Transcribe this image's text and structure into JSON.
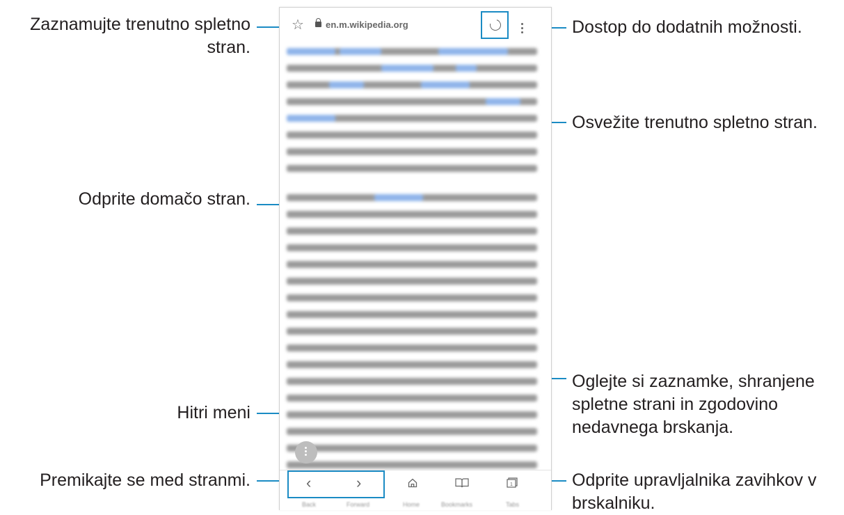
{
  "browser": {
    "url": "en.m.wikipedia.org",
    "icons": {
      "bookmark_star": "star-icon",
      "lock": "lock-icon",
      "refresh": "refresh-icon",
      "more": "more-options-icon"
    }
  },
  "bottom_nav": {
    "back": "‹",
    "forward": "›",
    "home_label": "Home",
    "bookmarks_label": "Bookmarks",
    "tabs_label": "Tabs",
    "back_label": "Back",
    "forward_label": "Forward",
    "tabs_count": "1"
  },
  "callouts": {
    "bookmark_current": "Zaznamujte trenutno spletno",
    "bookmark_current_2": "stran.",
    "more_options": "Dostop do dodatnih možnosti.",
    "refresh": "Osvežite trenutno spletno stran.",
    "home": "Odprite domačo stran.",
    "bookmarks_1": "Oglejte si zaznamke, shranjene",
    "bookmarks_2": "spletne strani in zgodovino",
    "bookmarks_3": "nedavnega brskanja.",
    "quick_menu": "Hitri meni",
    "navigate": "Premikajte se med stranmi.",
    "tabs_1": "Odprite upravljalnika zavihkov v",
    "tabs_2": "brskalniku."
  },
  "colors": {
    "accent": "#1a8bc4",
    "text": "#231f20"
  }
}
